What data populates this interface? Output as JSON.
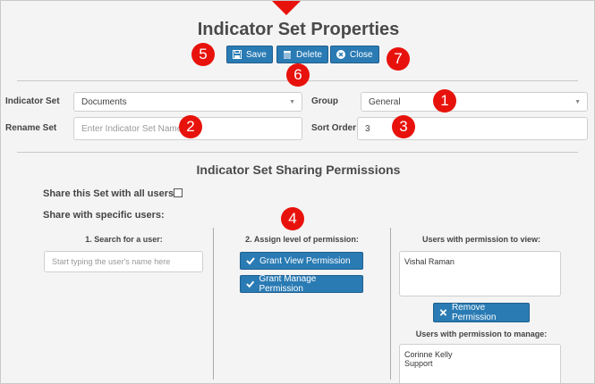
{
  "dialog": {
    "title": "Indicator Set Properties",
    "buttons": {
      "save": "Save",
      "delete": "Delete",
      "close": "Close"
    }
  },
  "form": {
    "indicator_set_label": "Indicator Set",
    "indicator_set_value": "Documents",
    "group_label": "Group",
    "group_value": "General",
    "rename_label": "Rename Set",
    "rename_placeholder": "Enter Indicator Set Name",
    "sort_order_label": "Sort Order",
    "sort_order_value": "3"
  },
  "sharing": {
    "title": "Indicator Set Sharing Permissions",
    "share_all_label": "Share this Set with all users:",
    "share_specific_label": "Share with specific users:",
    "search_heading": "1. Search for a user:",
    "search_placeholder": "Start typing the user's name here",
    "assign_heading": "2. Assign level of permission:",
    "grant_view_label": "Grant View Permission",
    "grant_manage_label": "Grant Manage Permission",
    "view_heading": "Users with permission to view:",
    "view_users": [
      "Vishal Raman"
    ],
    "remove_label": "Remove Permission",
    "manage_heading": "Users with permission to manage:",
    "manage_users": [
      "Corinne Kelly",
      "Support"
    ]
  },
  "callouts": [
    "1",
    "2",
    "3",
    "4",
    "5",
    "6",
    "7"
  ],
  "colors": {
    "accent": "#2a7bb4",
    "callout": "#e8120c"
  }
}
